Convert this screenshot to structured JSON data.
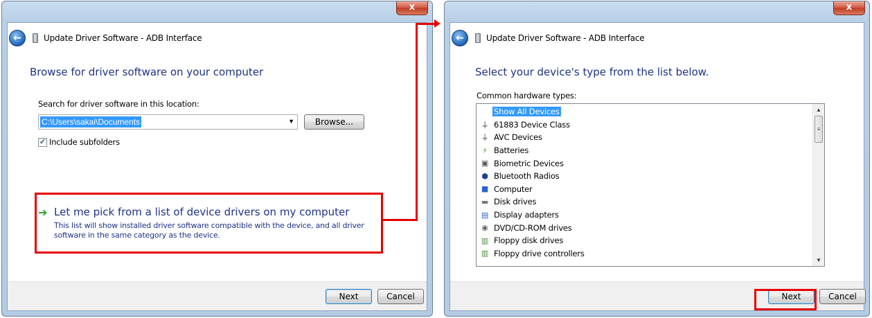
{
  "left_window": {
    "title": "Update Driver Software - ADB Interface",
    "close_glyph": "x",
    "heading": "Browse for driver software on your computer",
    "search_label": "Search for driver software in this location:",
    "path_value": "C:\\Users\\sakai\\Documents",
    "browse_label": "Browse...",
    "include_subfolders_label": "Include subfolders",
    "include_subfolders_checked": true,
    "pick_link_title": "Let me pick from a list of device drivers on my computer",
    "pick_link_description": "This list will show installed driver software compatible with the device, and all driver software in the same category as the device.",
    "next_label": "Next",
    "cancel_label": "Cancel"
  },
  "right_window": {
    "title": "Update Driver Software - ADB Interface",
    "close_glyph": "x",
    "heading": "Select your device's type from the list below.",
    "list_label": "Common hardware types:",
    "items": [
      {
        "label": "Show All Devices",
        "icon": "none",
        "selected": true
      },
      {
        "label": "61883 Device Class",
        "icon": "plug-icon"
      },
      {
        "label": "AVC Devices",
        "icon": "plug-icon"
      },
      {
        "label": "Batteries",
        "icon": "battery-icon"
      },
      {
        "label": "Biometric Devices",
        "icon": "fingerprint-icon"
      },
      {
        "label": "Bluetooth Radios",
        "icon": "bluetooth-icon"
      },
      {
        "label": "Computer",
        "icon": "computer-icon"
      },
      {
        "label": "Disk drives",
        "icon": "disk-drive-icon"
      },
      {
        "label": "Display adapters",
        "icon": "display-adapter-icon"
      },
      {
        "label": "DVD/CD-ROM drives",
        "icon": "dvd-drive-icon"
      },
      {
        "label": "Floppy disk drives",
        "icon": "floppy-drive-icon"
      },
      {
        "label": "Floppy drive controllers",
        "icon": "floppy-controller-icon"
      }
    ],
    "next_label": "Next",
    "cancel_label": "Cancel"
  },
  "colors": {
    "highlight": "#e60000",
    "heading_blue": "#1e3287",
    "selection_blue": "#3399ff"
  }
}
